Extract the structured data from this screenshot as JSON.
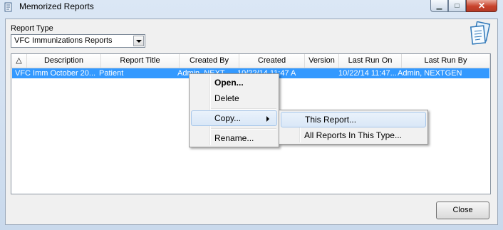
{
  "window": {
    "title": "Memorized Reports",
    "caption_minimize": "▁",
    "caption_maximize": "□",
    "caption_close": "✕"
  },
  "report_type": {
    "label": "Report Type",
    "selected": "VFC Immunizations Reports"
  },
  "grid": {
    "sort_indicator": "△",
    "columns": [
      "Description",
      "Report Title",
      "Created By",
      "Created",
      "Version",
      "Last Run On",
      "Last Run By"
    ],
    "rows": [
      {
        "description": "VFC Imm October 20...",
        "report_title": "Patient",
        "created_by": "Admin, NEXT...",
        "created": "10/22/14 11:47 A",
        "version": "",
        "last_run_on": "10/22/14 11:47...",
        "last_run_by": "Admin, NEXTGEN"
      }
    ]
  },
  "context_menu": {
    "open": "Open...",
    "delete": "Delete",
    "copy": "Copy...",
    "rename": "Rename..."
  },
  "copy_submenu": {
    "this_report": "This Report...",
    "all_reports": "All Reports In This Type..."
  },
  "buttons": {
    "close": "Close"
  }
}
